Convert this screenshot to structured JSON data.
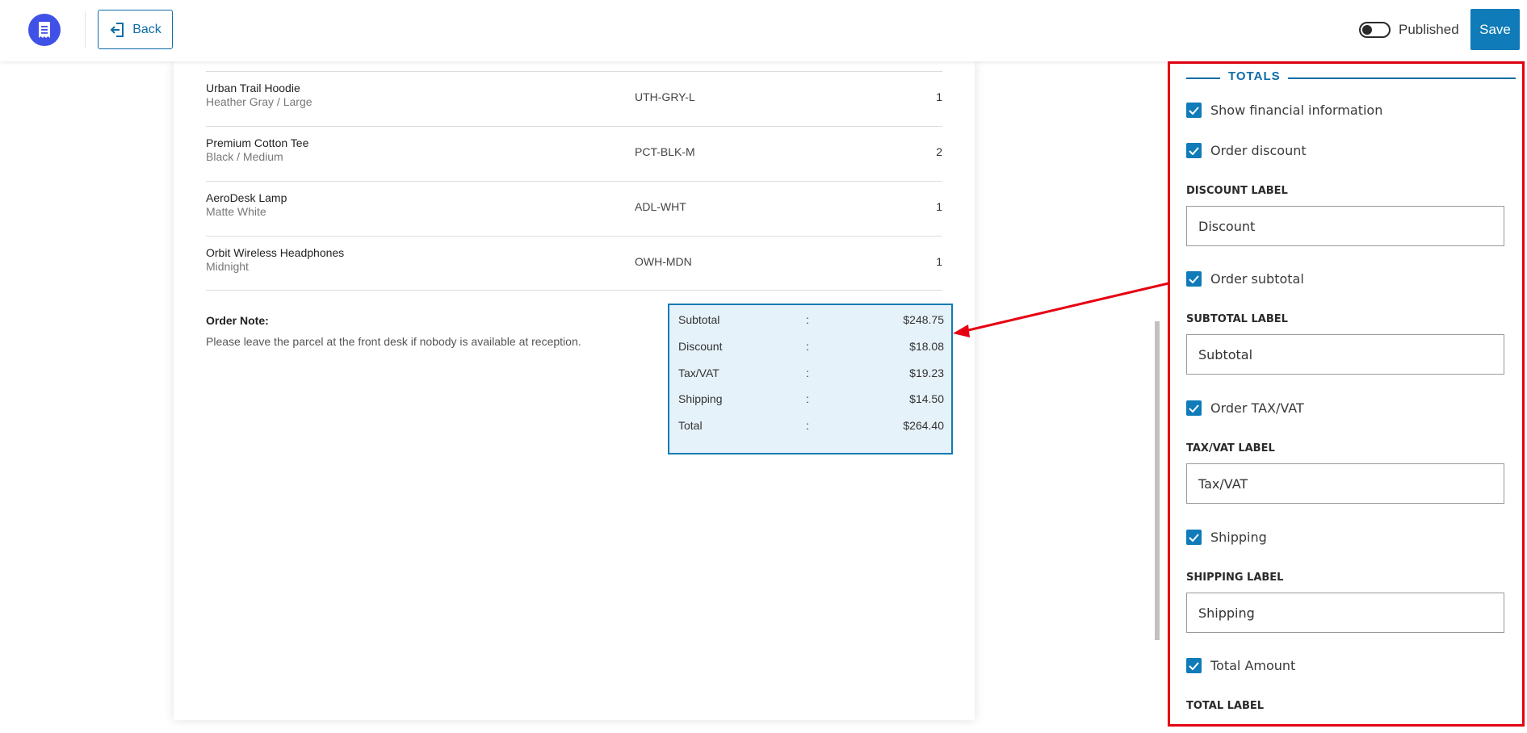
{
  "header": {
    "back_label": "Back",
    "published_label": "Published",
    "published_on": false,
    "save_label": "Save"
  },
  "items": [
    {
      "name": "Urban Trail Hoodie",
      "variant": "Heather Gray / Large",
      "sku": "UTH-GRY-L",
      "qty": "1"
    },
    {
      "name": "Premium Cotton Tee",
      "variant": "Black / Medium",
      "sku": "PCT-BLK-M",
      "qty": "2"
    },
    {
      "name": "AeroDesk Lamp",
      "variant": "Matte White",
      "sku": "ADL-WHT",
      "qty": "1"
    },
    {
      "name": "Orbit Wireless Headphones",
      "variant": "Midnight",
      "sku": "OWH-MDN",
      "qty": "1"
    }
  ],
  "note": {
    "title": "Order Note:",
    "text": "Please leave the parcel at the front desk if nobody is available at reception."
  },
  "totals": [
    {
      "label": "Subtotal",
      "sep": ":",
      "value": "$248.75"
    },
    {
      "label": "Discount",
      "sep": ":",
      "value": "$18.08"
    },
    {
      "label": "Tax/VAT",
      "sep": ":",
      "value": "$19.23"
    },
    {
      "label": "Shipping",
      "sep": ":",
      "value": "$14.50"
    },
    {
      "label": "Total",
      "sep": ":",
      "value": "$264.40"
    }
  ],
  "panel": {
    "section_title": "TOTALS",
    "show_financial": {
      "label": "Show financial information",
      "checked": true
    },
    "order_discount": {
      "label": "Order discount",
      "checked": true
    },
    "discount_label": {
      "label": "DISCOUNT LABEL",
      "value": "Discount"
    },
    "order_subtotal": {
      "label": "Order subtotal",
      "checked": true
    },
    "subtotal_label": {
      "label": "SUBTOTAL LABEL",
      "value": "Subtotal"
    },
    "order_tax": {
      "label": "Order TAX/VAT",
      "checked": true
    },
    "tax_label": {
      "label": "TAX/VAT LABEL",
      "value": "Tax/VAT"
    },
    "shipping": {
      "label": "Shipping",
      "checked": true
    },
    "shipping_label": {
      "label": "SHIPPING LABEL",
      "value": "Shipping"
    },
    "total_amount": {
      "label": "Total Amount",
      "checked": true
    },
    "total_label": {
      "label": "TOTAL LABEL"
    }
  },
  "colors": {
    "accent": "#0f7bb8",
    "brand": "#3f51e6",
    "highlight": "#e60012",
    "totals_bg": "#e6f2fa"
  }
}
